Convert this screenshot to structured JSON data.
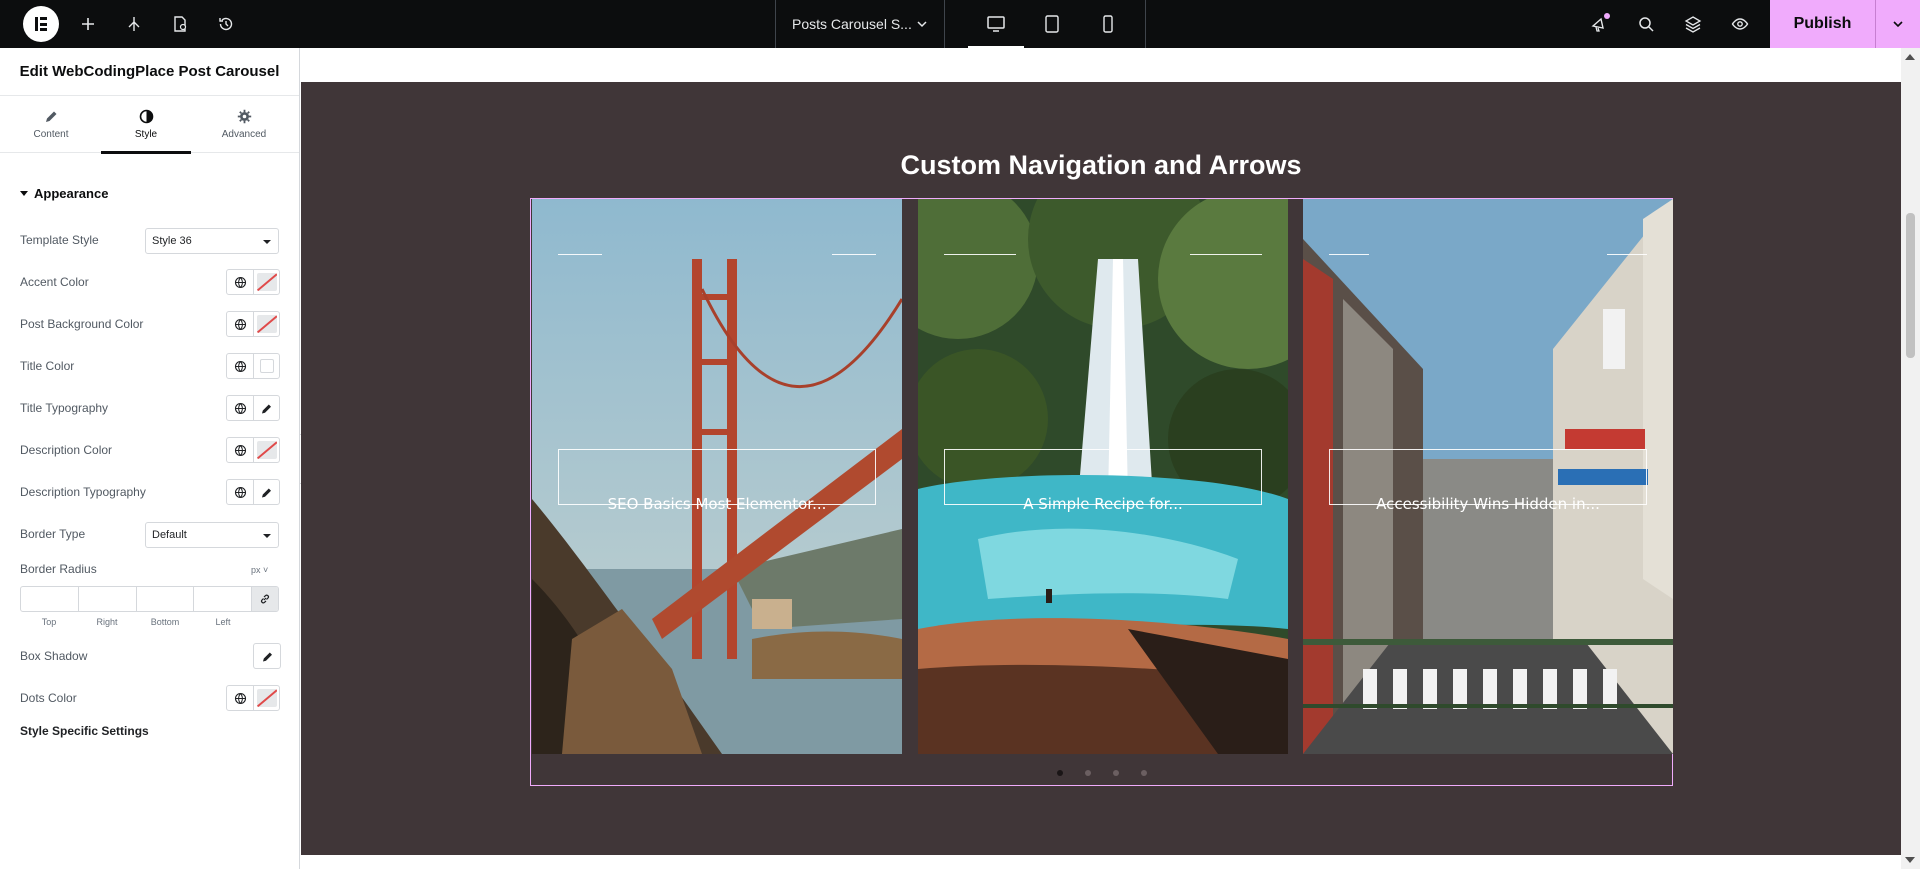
{
  "topbar": {
    "document_name": "Posts Carousel S...",
    "publish_label": "Publish",
    "active_device": "desktop",
    "icons": [
      "elementor-logo-icon",
      "add-icon",
      "structure-icon",
      "page-settings-icon",
      "history-icon",
      "whats-new-icon",
      "search-icon",
      "layers-icon",
      "preview-icon"
    ]
  },
  "panel": {
    "title": "Edit WebCodingPlace Post Carousel",
    "tabs": [
      {
        "label": "Content",
        "icon": "pencil-icon"
      },
      {
        "label": "Style",
        "icon": "half-circle-icon",
        "active": true
      },
      {
        "label": "Advanced",
        "icon": "gear-icon"
      }
    ],
    "section": "Appearance",
    "controls": {
      "template_style": {
        "label": "Template Style",
        "value": "Style 36"
      },
      "accent_color": {
        "label": "Accent Color"
      },
      "post_background_color": {
        "label": "Post Background Color"
      },
      "title_color": {
        "label": "Title Color"
      },
      "title_typography": {
        "label": "Title Typography"
      },
      "description_color": {
        "label": "Description Color"
      },
      "description_typography": {
        "label": "Description Typography"
      },
      "border_type": {
        "label": "Border Type",
        "value": "Default"
      },
      "border_radius": {
        "label": "Border Radius",
        "unit": "px",
        "sides": [
          "Top",
          "Right",
          "Bottom",
          "Left"
        ]
      },
      "box_shadow": {
        "label": "Box Shadow"
      },
      "dots_color": {
        "label": "Dots Color"
      }
    },
    "subsection": "Style Specific Settings"
  },
  "canvas": {
    "heading": "Custom Navigation and Arrows",
    "slides": [
      {
        "title": "SEO Basics Most Elementor..."
      },
      {
        "title": "A Simple Recipe for..."
      },
      {
        "title": "Accessibility Wins Hidden in..."
      }
    ],
    "dots": {
      "count": 4,
      "active_index": 0
    }
  },
  "colors": {
    "accent": "#f0abfc",
    "topbar": "#0c0d0e",
    "section_bg": "#403638"
  }
}
